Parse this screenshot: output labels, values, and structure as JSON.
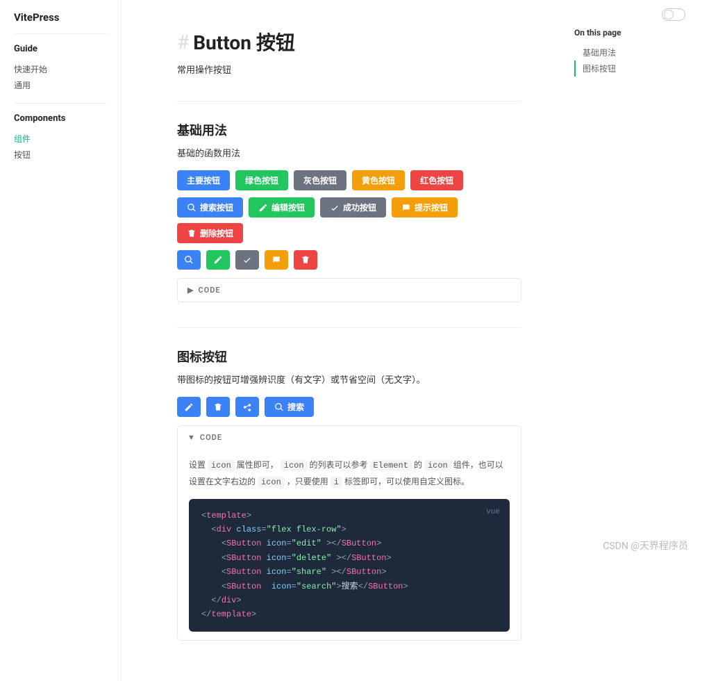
{
  "brand": "VitePress",
  "sidebar": {
    "groups": [
      {
        "title": "Guide",
        "items": [
          {
            "label": "快速开始",
            "active": false
          },
          {
            "label": "通用",
            "active": false
          }
        ]
      },
      {
        "title": "Components",
        "items": [
          {
            "label": "组件",
            "active": true
          },
          {
            "label": "按钮",
            "active": false
          }
        ]
      }
    ]
  },
  "aside": {
    "title": "On this page",
    "items": [
      {
        "label": "基础用法",
        "active": false
      },
      {
        "label": "图标按钮",
        "active": true
      }
    ]
  },
  "page": {
    "title": "Button 按钮",
    "subtitle": "常用操作按钮"
  },
  "sections": {
    "basic": {
      "title": "基础用法",
      "desc": "基础的函数用法",
      "row1": [
        "主要按钮",
        "绿色按钮",
        "灰色按钮",
        "黄色按钮",
        "红色按钮"
      ],
      "row2": [
        "搜索按钮",
        "编辑按钮",
        "成功按钮",
        "提示按钮",
        "删除按钮"
      ],
      "codeLabel": "CODE"
    },
    "icon": {
      "title": "图标按钮",
      "desc": "带图标的按钮可增强辨识度（有文字）或节省空间（无文字）。",
      "searchLabel": "搜索",
      "codeLabel": "CODE",
      "codeDesc": {
        "prefix": "设置 ",
        "c1": "icon",
        "mid1": " 属性即可， ",
        "c2": "icon",
        "mid2": " 的列表可以参考 ",
        "c3": "Element",
        "mid3": " 的 ",
        "c4": "icon",
        "mid4": " 组件，也可以设置在文字右边的 ",
        "c5": "icon",
        "mid5": " ，只要使用 ",
        "c6": "i",
        "mid6": " 标签即可，可以使用自定义图标。"
      },
      "codeLang": "vue",
      "code": {
        "l1": "<template>",
        "l2": "  <div class=\"flex flex-row\">",
        "l3": "    <SButton icon=\"edit\" ></SButton>",
        "l4": "    <SButton icon=\"delete\" ></SButton>",
        "l5": "    <SButton icon=\"share\" ></SButton>",
        "l6": "    <SButton  icon=\"search\">搜索</SButton>",
        "l7": "  </div>",
        "l8": "</template>"
      }
    }
  },
  "watermark": "CSDN @天界程序员"
}
